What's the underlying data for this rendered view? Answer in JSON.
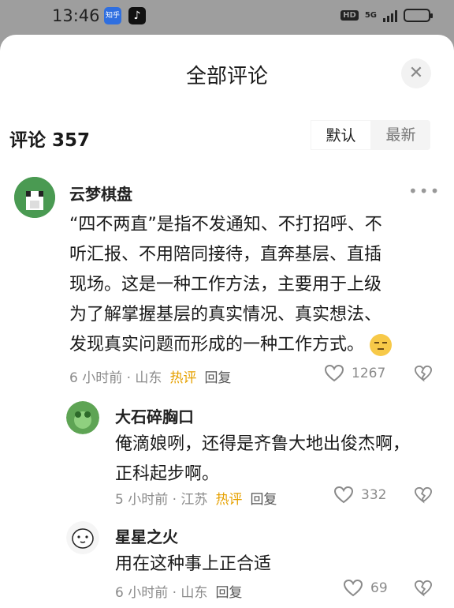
{
  "status_bar": {
    "time": "13:46",
    "app1": "知乎",
    "app2": "♪",
    "hd": "HD",
    "network": "5G"
  },
  "sheet": {
    "title": "全部评论",
    "close": "✕"
  },
  "comments_header": {
    "count_label": "评论 357",
    "sort_default": "默认",
    "sort_latest": "最新"
  },
  "comments": [
    {
      "user": "云梦棋盘",
      "text": "“四不两直”是指不发通知、不打招呼、不听汇报、不用陪同接待，直奔基层、直插现场。这是一种工作方法，主要用于上级为了解掌握基层的真实情况、真实想法、发现真实问题而形成的一种工作方式。",
      "lines": [
        "“四不两直”是指不发通知、不打招呼、不",
        "听汇报、不用陪同接待，直奔基层、直插",
        "现场。这是一种工作方法，主要用于上级",
        "为了解掌握基层的真实情况、真实想法、",
        "发现真实问题而形成的一种工作方式。"
      ],
      "time_loc": "6 小时前 · 山东",
      "hot": "热评",
      "reply": "回复",
      "likes": "1267"
    },
    {
      "user": "大石碎胸口",
      "lines": [
        "俺滴娘咧，还得是齐鲁大地出俊杰啊，",
        "正科起步啊。"
      ],
      "time_loc": "5 小时前 · 江苏",
      "hot": "热评",
      "reply": "回复",
      "likes": "332"
    },
    {
      "user": "星星之火",
      "lines": [
        "用在这种事上正合适"
      ],
      "time_loc": "6 小时前 · 山东",
      "reply": "回复",
      "likes": "69"
    }
  ],
  "more": "•••"
}
